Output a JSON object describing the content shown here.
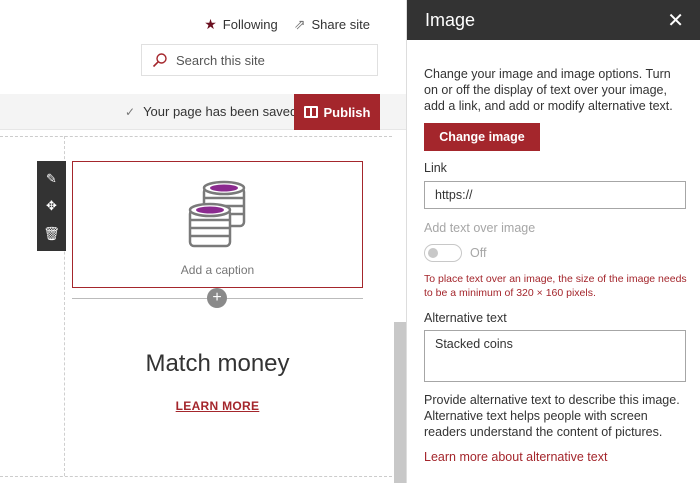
{
  "header": {
    "following_label": "Following",
    "share_label": "Share site",
    "search_placeholder": "Search this site"
  },
  "commandbar": {
    "saved_status": "Your page has been saved",
    "publish_label": "Publish"
  },
  "canvas": {
    "image_caption_placeholder": "Add a caption",
    "heading": "Match money",
    "link_text": "LEARN MORE"
  },
  "pane": {
    "title": "Image",
    "description": "Change your image and image options. Turn on or off the display of text over your image, add a link, and add or modify alternative text.",
    "change_image_label": "Change image",
    "link_label": "Link",
    "link_value": "https://",
    "text_over_image_label": "Add text over image",
    "toggle_state": "Off",
    "warning": "To place text over an image, the size of the image needs to be a minimum of 320 × 160 pixels.",
    "alt_text_label": "Alternative text",
    "alt_text_value": "Stacked coins",
    "alt_help": "Provide alternative text to describe this image. Alternative text helps people with screen readers understand the content of pictures.",
    "alt_learn_link": "Learn more about alternative text"
  },
  "colors": {
    "accent": "#a4262c",
    "pane_header": "#333333",
    "coin_fill": "#8b2a8f"
  }
}
